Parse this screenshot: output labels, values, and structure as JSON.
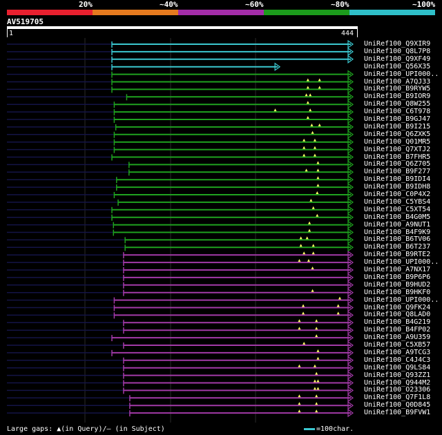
{
  "identity_scale": {
    "labels": [
      "20%",
      "~40%",
      "~60%",
      "~80%",
      "~100%"
    ],
    "colors": [
      "#e8202f",
      "#e57a1f",
      "#a32da8",
      "#1c9b1c",
      "#2fbfc9"
    ]
  },
  "query": {
    "name": "AV519705",
    "start": "1",
    "end": "444",
    "length": 444
  },
  "hits": [
    {
      "name": "UniRef100_Q9XIR9",
      "color": "#3bc8d0",
      "start": 135,
      "end": 444,
      "tick": 0,
      "gaps": []
    },
    {
      "name": "UniRef100_Q8L7P8",
      "color": "#3bc8d0",
      "start": 135,
      "end": 444,
      "tick": 0,
      "gaps": []
    },
    {
      "name": "UniRef100_Q9XF49",
      "color": "#3bc8d0",
      "start": 135,
      "end": 444,
      "tick": 0,
      "gaps": []
    },
    {
      "name": "UniRef100_Q56X35",
      "color": "#3bc8d0",
      "start": 135,
      "end": 350,
      "tick": 0,
      "gaps": []
    },
    {
      "name": "UniRef100_UPI000..",
      "color": "#1fa21f",
      "start": 135,
      "end": 444,
      "tick": 0,
      "gaps": []
    },
    {
      "name": "UniRef100_A7QJ33",
      "color": "#1fa21f",
      "start": 135,
      "end": 444,
      "tick": 0,
      "gaps": [
        387,
        402
      ]
    },
    {
      "name": "UniRef100_B9RYW5",
      "color": "#1fa21f",
      "start": 135,
      "end": 444,
      "tick": 0,
      "gaps": [
        387,
        402
      ]
    },
    {
      "name": "UniRef100_B9IOR9",
      "color": "#1fa21f",
      "start": 154,
      "end": 444,
      "tick": 0,
      "gaps": [
        385,
        390
      ]
    },
    {
      "name": "UniRef100_Q8W255",
      "color": "#1fa21f",
      "start": 138,
      "end": 444,
      "tick": 0,
      "gaps": [
        387
      ]
    },
    {
      "name": "UniRef100_C6T978",
      "color": "#1fa21f",
      "start": 138,
      "end": 444,
      "tick": 0,
      "gaps": [
        345,
        390
      ]
    },
    {
      "name": "UniRef100_B9GJ47",
      "color": "#1fa21f",
      "start": 138,
      "end": 444,
      "tick": 0,
      "gaps": [
        387
      ]
    },
    {
      "name": "UniRef100_B9I215",
      "color": "#1fa21f",
      "start": 140,
      "end": 444,
      "tick": 0,
      "gaps": [
        392,
        402
      ]
    },
    {
      "name": "UniRef100_Q6ZXK5",
      "color": "#1fa21f",
      "start": 138,
      "end": 444,
      "tick": 0,
      "gaps": [
        393
      ]
    },
    {
      "name": "UniRef100_Q01MR5",
      "color": "#1fa21f",
      "start": 138,
      "end": 444,
      "tick": 0,
      "gaps": [
        382,
        396
      ]
    },
    {
      "name": "UniRef100_Q7XTJ2",
      "color": "#1fa21f",
      "start": 138,
      "end": 444,
      "tick": 0,
      "gaps": [
        382,
        396
      ]
    },
    {
      "name": "UniRef100_B7FHR5",
      "color": "#1fa21f",
      "start": 135,
      "end": 444,
      "tick": 0,
      "gaps": [
        382,
        396
      ]
    },
    {
      "name": "UniRef100_Q6Z705",
      "color": "#1fa21f",
      "start": 157,
      "end": 444,
      "tick": 0,
      "gaps": [
        400
      ]
    },
    {
      "name": "UniRef100_B9F277",
      "color": "#1fa21f",
      "start": 157,
      "end": 444,
      "tick": 0,
      "gaps": [
        385,
        400
      ]
    },
    {
      "name": "UniRef100_B9IDI4",
      "color": "#1fa21f",
      "start": 141,
      "end": 444,
      "tick": 0,
      "gaps": [
        400
      ]
    },
    {
      "name": "UniRef100_B9IDH8",
      "color": "#1fa21f",
      "start": 141,
      "end": 444,
      "tick": 0,
      "gaps": [
        400
      ]
    },
    {
      "name": "UniRef100_C0P4X2",
      "color": "#1fa21f",
      "start": 138,
      "end": 444,
      "tick": 0,
      "gaps": [
        399
      ]
    },
    {
      "name": "UniRef100_C5YBS4",
      "color": "#1fa21f",
      "start": 143,
      "end": 444,
      "tick": 0,
      "gaps": [
        391
      ]
    },
    {
      "name": "UniRef100_C5XT54",
      "color": "#1fa21f",
      "start": 135,
      "end": 444,
      "tick": 0,
      "gaps": [
        394
      ]
    },
    {
      "name": "UniRef100_B4G0M5",
      "color": "#1fa21f",
      "start": 135,
      "end": 444,
      "tick": 0,
      "gaps": [
        399
      ]
    },
    {
      "name": "UniRef100_A9NUT1",
      "color": "#1fa21f",
      "start": 137,
      "end": 444,
      "tick": 0,
      "gaps": [
        389
      ]
    },
    {
      "name": "UniRef100_B4F9K9",
      "color": "#1fa21f",
      "start": 137,
      "end": 444,
      "tick": 0,
      "gaps": [
        389
      ]
    },
    {
      "name": "UniRef100_B6TV06",
      "color": "#1fa21f",
      "start": 152,
      "end": 444,
      "tick": 0,
      "gaps": [
        378,
        386
      ]
    },
    {
      "name": "UniRef100_B6T237",
      "color": "#1fa21f",
      "start": 152,
      "end": 444,
      "tick": 0,
      "gaps": [
        378,
        394
      ]
    },
    {
      "name": "UniRef100_B9RTE2",
      "color": "#a33aa8",
      "start": 150,
      "end": 444,
      "tick": 0,
      "gaps": [
        382,
        394
      ]
    },
    {
      "name": "UniRef100_UPI000..",
      "color": "#a33aa8",
      "start": 150,
      "end": 444,
      "tick": 0,
      "gaps": [
        376,
        388
      ]
    },
    {
      "name": "UniRef100_A7NX17",
      "color": "#a33aa8",
      "start": 150,
      "end": 444,
      "tick": 0,
      "gaps": [
        393
      ]
    },
    {
      "name": "UniRef100_B9P6P6",
      "color": "#a33aa8",
      "start": 150,
      "end": 444,
      "tick": 0,
      "gaps": []
    },
    {
      "name": "UniRef100_B9HUD2",
      "color": "#a33aa8",
      "start": 150,
      "end": 444,
      "tick": 0,
      "gaps": []
    },
    {
      "name": "UniRef100_B9HKF0",
      "color": "#a33aa8",
      "start": 150,
      "end": 444,
      "tick": 0,
      "gaps": [
        393
      ]
    },
    {
      "name": "UniRef100_UPI000..",
      "color": "#a33aa8",
      "start": 138,
      "end": 444,
      "tick": 0,
      "gaps": [
        428
      ]
    },
    {
      "name": "UniRef100_Q9FK24",
      "color": "#a33aa8",
      "start": 138,
      "end": 444,
      "tick": 0,
      "gaps": [
        381,
        426
      ]
    },
    {
      "name": "UniRef100_Q8LAD0",
      "color": "#a33aa8",
      "start": 138,
      "end": 444,
      "tick": 0,
      "gaps": [
        381,
        426
      ]
    },
    {
      "name": "UniRef100_B4G219",
      "color": "#a33aa8",
      "start": 150,
      "end": 444,
      "tick": 0,
      "gaps": [
        376,
        398
      ]
    },
    {
      "name": "UniRef100_B4FP02",
      "color": "#a33aa8",
      "start": 150,
      "end": 444,
      "tick": 0,
      "gaps": [
        376,
        398
      ]
    },
    {
      "name": "UniRef100_A9U359",
      "color": "#a33aa8",
      "start": 135,
      "end": 444,
      "tick": 0,
      "gaps": [
        398
      ]
    },
    {
      "name": "UniRef100_C5XB57",
      "color": "#a33aa8",
      "start": 150,
      "end": 444,
      "tick": 0,
      "gaps": [
        382
      ]
    },
    {
      "name": "UniRef100_A9TCG3",
      "color": "#a33aa8",
      "start": 135,
      "end": 444,
      "tick": 0,
      "gaps": [
        400
      ]
    },
    {
      "name": "UniRef100_C4J4C3",
      "color": "#a33aa8",
      "start": 150,
      "end": 444,
      "tick": 0,
      "gaps": [
        400
      ]
    },
    {
      "name": "UniRef100_Q9LS84",
      "color": "#a33aa8",
      "start": 150,
      "end": 444,
      "tick": 0,
      "gaps": [
        376,
        396
      ]
    },
    {
      "name": "UniRef100_Q93ZZ1",
      "color": "#a33aa8",
      "start": 150,
      "end": 444,
      "tick": 0,
      "gaps": [
        398
      ]
    },
    {
      "name": "UniRef100_Q944M2",
      "color": "#a33aa8",
      "start": 150,
      "end": 444,
      "tick": 0,
      "gaps": [
        396,
        400
      ]
    },
    {
      "name": "UniRef100_O23306",
      "color": "#a33aa8",
      "start": 150,
      "end": 444,
      "tick": 0,
      "gaps": [
        396,
        400
      ]
    },
    {
      "name": "UniRef100_Q7F1L8",
      "color": "#a33aa8",
      "start": 158,
      "end": 444,
      "tick": 0,
      "gaps": [
        376,
        398
      ]
    },
    {
      "name": "UniRef100_Q0D845",
      "color": "#a33aa8",
      "start": 158,
      "end": 444,
      "tick": 0,
      "gaps": [
        376,
        398
      ]
    },
    {
      "name": "UniRef100_B9FVW1",
      "color": "#a33aa8",
      "start": 158,
      "end": 444,
      "tick": 0,
      "gaps": [
        376,
        398
      ]
    }
  ],
  "legend": {
    "text": "Large gaps: ▲(in Query)/— (in Subject)",
    "scale_text": "=100char."
  },
  "colors": {
    "background": "#000000",
    "leader": "#141447",
    "query_bar": "#ffffff",
    "gap_marker": "#ffff66"
  }
}
